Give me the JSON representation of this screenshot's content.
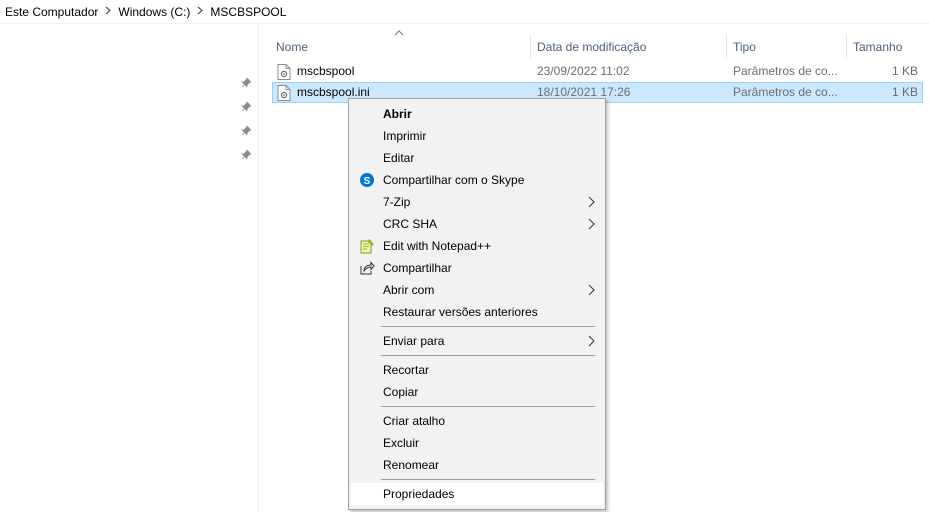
{
  "breadcrumb": {
    "items": [
      "Este Computador",
      "Windows (C:)",
      "MSCBSPOOL"
    ]
  },
  "columns": {
    "name": "Nome",
    "date": "Data de modificação",
    "type": "Tipo",
    "size": "Tamanho"
  },
  "files": [
    {
      "name": "mscbspool",
      "date": "23/09/2022 11:02",
      "type": "Parâmetros de co...",
      "size": "1 KB"
    },
    {
      "name": "mscbspool.ini",
      "date": "18/10/2021 17:26",
      "type": "Parâmetros de co...",
      "size": "1 KB"
    }
  ],
  "context_menu": {
    "open": "Abrir",
    "print": "Imprimir",
    "edit": "Editar",
    "skype": "Compartilhar com o Skype",
    "zip": "7-Zip",
    "crc": "CRC SHA",
    "notepadpp": "Edit with Notepad++",
    "share": "Compartilhar",
    "open_with": "Abrir com",
    "restore": "Restaurar versões anteriores",
    "send_to": "Enviar para",
    "cut": "Recortar",
    "copy": "Copiar",
    "shortcut": "Criar atalho",
    "delete": "Excluir",
    "rename": "Renomear",
    "properties": "Propriedades"
  },
  "colors": {
    "selection": "#cce8ff",
    "selection_border": "#99d1ff",
    "skype": "#0078d4",
    "header_text": "#4c607a"
  },
  "icons": [
    "chevron-right-icon",
    "pin-icon",
    "sort-up-icon",
    "ini-file-icon",
    "skype-icon",
    "notepadpp-icon",
    "share-icon",
    "submenu-arrow-icon"
  ]
}
